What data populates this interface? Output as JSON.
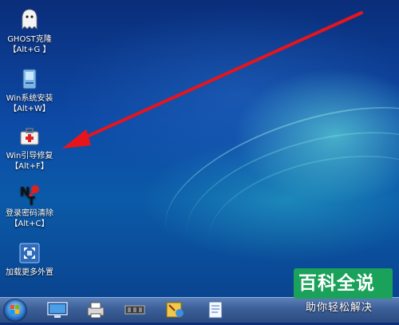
{
  "desktop_icons": [
    {
      "label": "GHOST克隆",
      "hotkey": "【Alt+G 】",
      "icon": "ghost-icon"
    },
    {
      "label": "Win系统安装",
      "hotkey": "【Alt+W】",
      "icon": "install-disk-icon"
    },
    {
      "label": "Win引导修复",
      "hotkey": "【Alt+F】",
      "icon": "repair-kit-icon"
    },
    {
      "label": "登录密码清除",
      "hotkey": "【Alt+C】",
      "icon": "password-clear-icon"
    },
    {
      "label": "加载更多外置",
      "hotkey": "",
      "icon": "load-more-icon"
    }
  ],
  "taskbar": {
    "items": [
      "start-orb-icon",
      "monitor-icon",
      "printer-icon",
      "memory-chip-icon",
      "tools-icon",
      "notepad-icon"
    ]
  },
  "watermark": {
    "title": "百科全说",
    "subtitle": "助你轻松解决"
  },
  "colors": {
    "arrow": "#e8141c",
    "watermark_bg": "#1aa25a"
  }
}
